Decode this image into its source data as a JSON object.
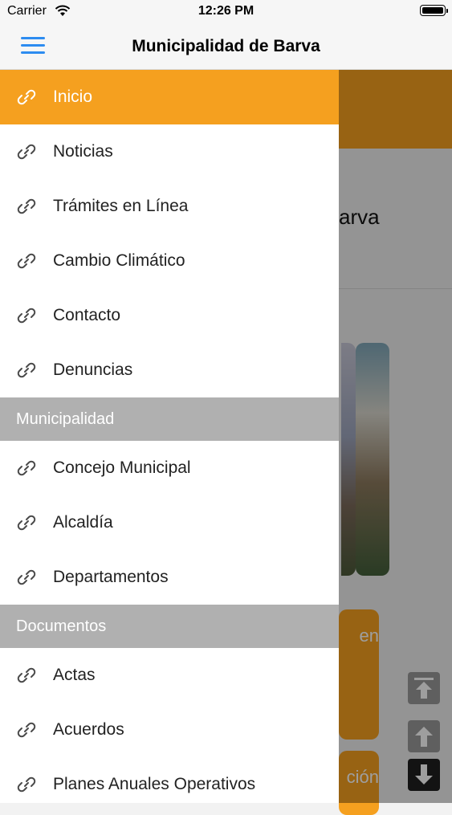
{
  "status_bar": {
    "carrier": "Carrier",
    "time": "12:26 PM"
  },
  "navbar": {
    "title": "Municipalidad de Barva",
    "menu_icon": "hamburger-menu-icon"
  },
  "background": {
    "heading_fragment": "arva",
    "tile1_fragment": "en",
    "tile2_fragment": "ción"
  },
  "drawer": {
    "items_top": [
      {
        "label": "Inicio",
        "active": true
      },
      {
        "label": "Noticias"
      },
      {
        "label": "Trámites en Línea"
      },
      {
        "label": "Cambio Climático"
      },
      {
        "label": "Contacto"
      },
      {
        "label": "Denuncias"
      }
    ],
    "section_municipalidad": "Municipalidad",
    "items_municipalidad": [
      {
        "label": "Concejo Municipal"
      },
      {
        "label": "Alcaldía"
      },
      {
        "label": "Departamentos"
      }
    ],
    "section_documentos": "Documentos",
    "items_documentos": [
      {
        "label": "Actas"
      },
      {
        "label": "Acuerdos"
      },
      {
        "label": "Planes Anuales Operativos"
      }
    ]
  },
  "colors": {
    "accent": "#f5a01f",
    "nav_blue": "#2d8cf0",
    "section_gray": "#b0b0b0"
  }
}
